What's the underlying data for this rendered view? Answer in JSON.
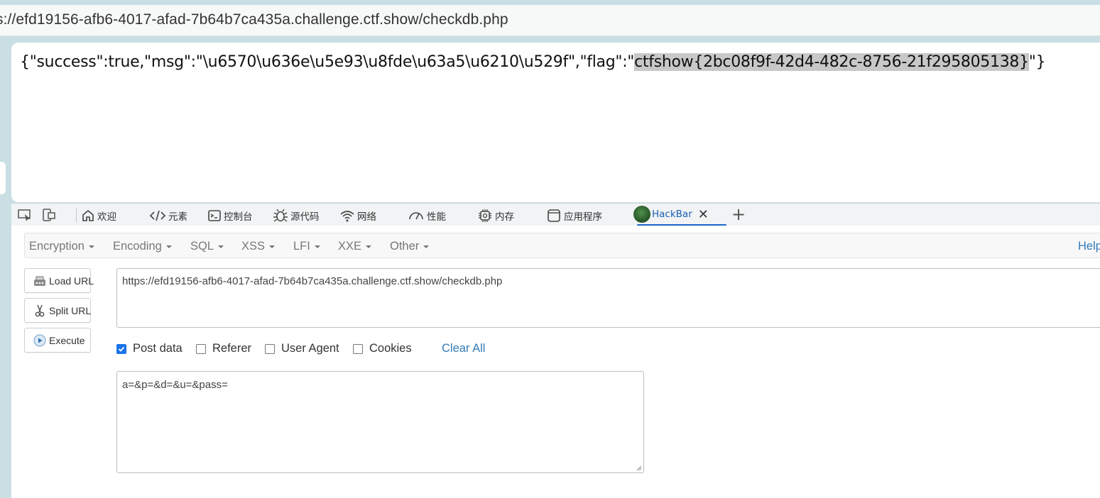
{
  "address_bar": {
    "url": "s://efd19156-afb6-4017-afad-7b64b7ca435a.challenge.ctf.show/checkdb.php"
  },
  "page": {
    "json_prefix": "{\"success\":true,\"msg\":\"\\u6570\\u636e\\u5e93\\u8fde\\u63a5\\u6210\\u529f\",\"flag\":\"",
    "flag_highlighted": "ctfshow{2bc08f9f-42d4-482c-8756-21f295805138}",
    "json_suffix": "\"}"
  },
  "devtools": {
    "tabs": [
      {
        "label": "欢迎",
        "icon": "home-icon"
      },
      {
        "label": "元素",
        "icon": "code-icon"
      },
      {
        "label": "控制台",
        "icon": "console-icon"
      },
      {
        "label": "源代码",
        "icon": "bug-icon"
      },
      {
        "label": "网络",
        "icon": "wifi-icon"
      },
      {
        "label": "性能",
        "icon": "gauge-icon"
      },
      {
        "label": "内存",
        "icon": "chip-icon"
      },
      {
        "label": "应用程序",
        "icon": "window-icon"
      },
      {
        "label": "HackBar",
        "icon": "hackbar-logo-icon"
      }
    ],
    "active_tab": "HackBar",
    "add_tab_glyph": "+",
    "close_glyph": "✕"
  },
  "hackbar": {
    "menu": [
      "Encryption",
      "Encoding",
      "SQL",
      "XSS",
      "LFI",
      "XXE",
      "Other"
    ],
    "help_label": "Help",
    "buttons": {
      "load_url": "Load URL",
      "split_url": "Split URL",
      "execute": "Execute"
    },
    "url_value": "https://efd19156-afb6-4017-afad-7b64b7ca435a.challenge.ctf.show/checkdb.php",
    "options": [
      {
        "label": "Post data",
        "checked": true
      },
      {
        "label": "Referer",
        "checked": false
      },
      {
        "label": "User Agent",
        "checked": false
      },
      {
        "label": "Cookies",
        "checked": false
      }
    ],
    "clear_all_label": "Clear All",
    "post_data_value": "a=&p=&d=&u=&pass="
  },
  "colors": {
    "accent": "#1b66c9",
    "link": "#337ab7",
    "highlight": "#c8c8c8",
    "checkbox_on": "#1a73e8"
  }
}
